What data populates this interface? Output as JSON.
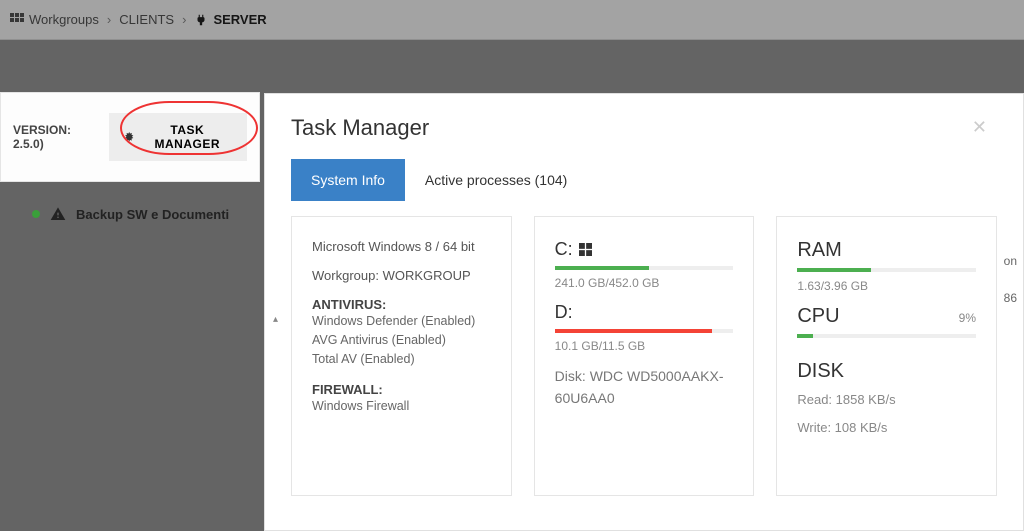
{
  "breadcrumb": {
    "root": "Workgroups",
    "client": "CLIENTS",
    "server": "SERVER"
  },
  "sidepanel": {
    "version_label": "VERSION: 2.5.0)",
    "task_btn": "TASK MANAGER",
    "backup_label": "Backup SW e Documenti"
  },
  "modal": {
    "title": "Task Manager",
    "tabs": {
      "system": "System Info",
      "processes": "Active processes (104)"
    },
    "sysinfo": {
      "os": "Microsoft Windows 8 / 64 bit",
      "workgroup_label": "Workgroup:",
      "workgroup_value": "WORKGROUP",
      "av_label": "ANTIVIRUS:",
      "av1": "Windows Defender (Enabled)",
      "av2": "AVG Antivirus (Enabled)",
      "av3": "Total AV (Enabled)",
      "fw_label": "FIREWALL:",
      "fw1": "Windows Firewall"
    },
    "disks": {
      "c_label": "C:",
      "c_used": "241.0 GB/452.0 GB",
      "c_pct": 53,
      "d_label": "D:",
      "d_used": "10.1 GB/11.5 GB",
      "d_pct": 88,
      "model_label": "Disk:",
      "model": "WDC WD5000AAKX-60U6AA0"
    },
    "stats": {
      "ram_label": "RAM",
      "ram_used": "1.63/3.96 GB",
      "ram_pct": 41,
      "cpu_label": "CPU",
      "cpu_pct_text": "9%",
      "cpu_pct": 9,
      "disk_label": "DISK",
      "read": "Read: 1858 KB/s",
      "write": "Write: 108 KB/s"
    }
  },
  "bg": {
    "col_on": "on",
    "num_86": "86"
  }
}
